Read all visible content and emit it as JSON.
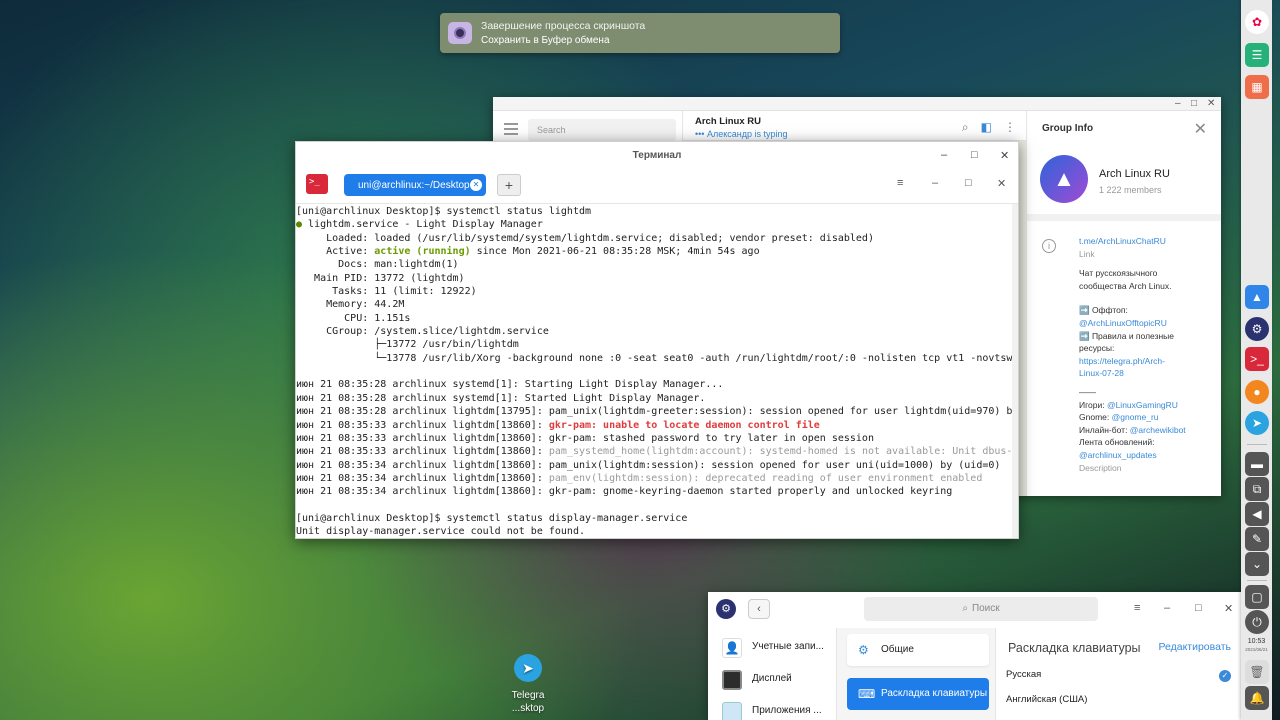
{
  "notification": {
    "title": "Завершение процесса скриншота",
    "body": "Сохранить в Буфер обмена"
  },
  "telegram": {
    "search_placeholder": "Search",
    "chat": {
      "name": "Arch Linux RU",
      "typing": "••• Александр is typing"
    },
    "group_info": {
      "header": "Group Info",
      "name": "Arch Linux RU",
      "members": "1 222 members",
      "link": "t.me/ArchLinuxChatRU",
      "link_label": "Link",
      "desc_line1": "Чат русскоязычного",
      "desc_line2": "сообщества Arch Linux.",
      "offtop_label": "➡️ Оффтоп:",
      "offtop_link": "@ArchLinuxOfftopicRU",
      "rules_label1": "➡️ Правила и полезные",
      "rules_label2": "ресурсы:",
      "rules_link1": "https://telegra.ph/Arch-",
      "rules_link2": "Linux-07-28",
      "divider": "——",
      "games_label": "Игори: ",
      "games_link": "@LinuxGamingRU",
      "gnome_label": "Gnome: ",
      "gnome_link": "@gnome_ru",
      "inline_label": "Инлайн-бот: ",
      "inline_link": "@archewikibot",
      "updates_label": "Лента обновлений:",
      "updates_link": "@archlinux_updates",
      "desc_label": "Description"
    }
  },
  "terminal": {
    "title": "Терминал",
    "tab_label": "uni@archlinux:~/Desktop",
    "lines": {
      "l1": "[uni@archlinux Desktop]$ systemctl status lightdm",
      "l2a": "●",
      "l2b": " lightdm.service - Light Display Manager",
      "l3": "     Loaded: loaded (/usr/lib/systemd/system/lightdm.service; disabled; vendor preset: disabled)",
      "l4a": "     Active: ",
      "l4b": "active (running)",
      "l4c": " since Mon 2021-06-21 08:35:28 MSK; 4min 54s ago",
      "l5": "       Docs: man:lightdm(1)",
      "l6": "   Main PID: 13772 (lightdm)",
      "l7": "      Tasks: 11 (limit: 12922)",
      "l8": "     Memory: 44.2M",
      "l9": "        CPU: 1.151s",
      "l10": "     CGroup: /system.slice/lightdm.service",
      "l11": "             ├─13772 /usr/bin/lightdm",
      "l12": "             └─13778 /usr/lib/Xorg -background none :0 -seat seat0 -auth /run/lightdm/root/:0 -nolisten tcp vt1 -novtsw",
      "l13": "",
      "l14": "июн 21 08:35:28 archlinux systemd[1]: Starting Light Display Manager...",
      "l15": "июн 21 08:35:28 archlinux systemd[1]: Started Light Display Manager.",
      "l16": "июн 21 08:35:28 archlinux lightdm[13795]: pam_unix(lightdm-greeter:session): session opened for user lightdm(uid=970) b",
      "l17a": "июн 21 08:35:33 archlinux lightdm[13860]: ",
      "l17b": "gkr-pam: unable to locate daemon control file",
      "l18": "июн 21 08:35:33 archlinux lightdm[13860]: gkr-pam: stashed password to try later in open session",
      "l19a": "июн 21 08:35:33 archlinux lightdm[13860]: ",
      "l19b": "pam_systemd_home(lightdm:account): systemd-homed is not available: Unit dbus-",
      "l20": "июн 21 08:35:34 archlinux lightdm[13860]: pam_unix(lightdm:session): session opened for user uni(uid=1000) by (uid=0)",
      "l21a": "июн 21 08:35:34 archlinux lightdm[13860]: ",
      "l21b": "pam_env(lightdm:session): deprecated reading of user environment enabled",
      "l22": "июн 21 08:35:34 archlinux lightdm[13860]: gkr-pam: gnome-keyring-daemon started properly and unlocked keyring",
      "l23": "",
      "l24": "[uni@archlinux Desktop]$ systemctl status display-manager.service",
      "l25": "Unit display-manager.service could not be found.",
      "overflow": ">"
    }
  },
  "settings": {
    "search_placeholder": "Поиск",
    "nav": [
      "Учетные запи...",
      "Дисплей",
      "Приложения ..."
    ],
    "mid": [
      "Общие",
      "Раскладка клавиатуры"
    ],
    "heading": "Раскладка клавиатуры",
    "edit": "Редактировать",
    "languages": [
      "Русская",
      "Английская (США)"
    ]
  },
  "desktop_icon": {
    "line1": "Telegra",
    "line2": "...sktop"
  },
  "dock": {
    "time": "10:53",
    "date": "2021/06/21"
  }
}
